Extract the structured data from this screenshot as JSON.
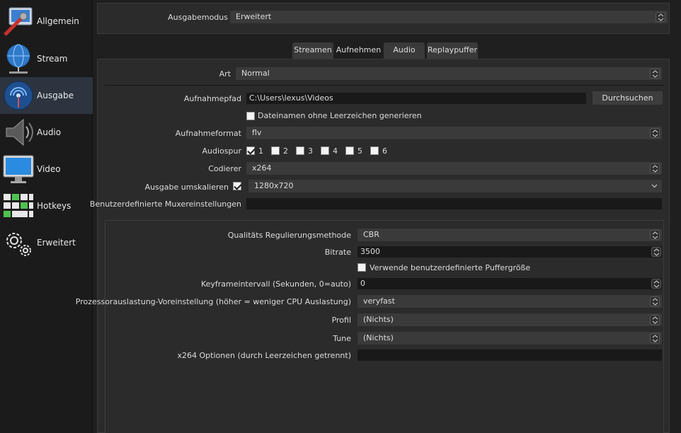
{
  "sidebar": {
    "items": [
      {
        "label": "Allgemein",
        "icon": "general-settings-icon"
      },
      {
        "label": "Stream",
        "icon": "globe-stream-icon"
      },
      {
        "label": "Ausgabe",
        "icon": "output-broadcast-icon"
      },
      {
        "label": "Audio",
        "icon": "speaker-icon"
      },
      {
        "label": "Video",
        "icon": "monitor-icon"
      },
      {
        "label": "Hotkeys",
        "icon": "keyboard-icon"
      },
      {
        "label": "Erweitert",
        "icon": "gears-icon"
      }
    ],
    "active_index": 2
  },
  "output_mode": {
    "label": "Ausgabemodus",
    "value": "Erweitert"
  },
  "tabs": [
    {
      "label": "Streamen"
    },
    {
      "label": "Aufnehmen"
    },
    {
      "label": "Audio"
    },
    {
      "label": "Replaypuffer"
    }
  ],
  "active_tab": "Aufnehmen",
  "recording": {
    "type_label": "Art",
    "type_value": "Normal",
    "path_label": "Aufnahmepfad",
    "path_value": "C:\\Users\\lexus\\Videos",
    "browse_label": "Durchsuchen",
    "no_space_label": "Dateinamen ohne Leerzeichen generieren",
    "format_label": "Aufnahmeformat",
    "format_value": "flv",
    "tracks_label": "Audiospur",
    "tracks": [
      {
        "label": "1",
        "checked": true
      },
      {
        "label": "2",
        "checked": false
      },
      {
        "label": "3",
        "checked": false
      },
      {
        "label": "4",
        "checked": false
      },
      {
        "label": "5",
        "checked": false
      },
      {
        "label": "6",
        "checked": false
      }
    ],
    "encoder_label": "Codierer",
    "encoder_value": "x264",
    "rescale_label": "Ausgabe umskalieren",
    "rescale_value": "1280x720",
    "muxer_label": "Benutzerdefinierte Muxereinstellungen",
    "muxer_value": ""
  },
  "encoder_settings": {
    "rate_control_label": "Qualitäts Regulierungsmethode",
    "rate_control_value": "CBR",
    "bitrate_label": "Bitrate",
    "bitrate_value": "3500",
    "custom_buffer_label": "Verwende benutzerdefinierte Puffergröße",
    "keyframe_label": "Keyframeintervall (Sekunden, 0=auto)",
    "keyframe_value": "0",
    "preset_label": "Prozessorauslastung-Voreinstellung (höher = weniger CPU Auslastung)",
    "preset_value": "veryfast",
    "profile_label": "Profil",
    "profile_value": "(Nichts)",
    "tune_label": "Tune",
    "tune_value": "(Nichts)",
    "x264opts_label": "x264 Optionen (durch Leerzeichen getrennt)",
    "x264opts_value": ""
  }
}
